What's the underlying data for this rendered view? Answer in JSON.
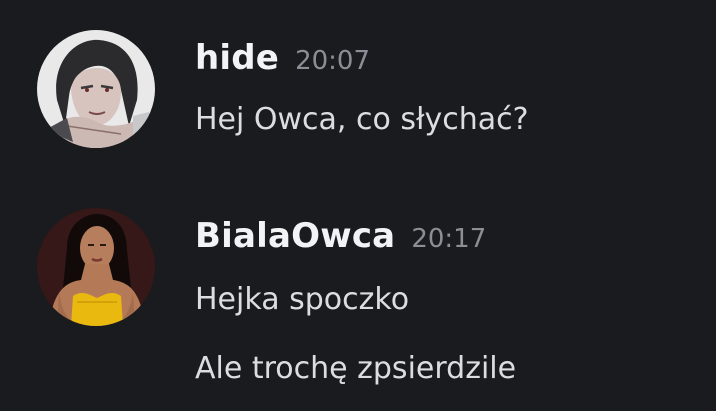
{
  "messages": [
    {
      "author": "hide",
      "time": "20:07",
      "avatar_icon": "avatar-sketch-character",
      "lines": [
        "Hej Owca, co słychać?"
      ]
    },
    {
      "author": "BialaOwca",
      "time": "20:17",
      "avatar_icon": "avatar-photo-woman",
      "lines": [
        "Hejka spoczko",
        "Ale trochę zpsierdzile"
      ]
    }
  ],
  "colors": {
    "background": "#1a1b1f",
    "username": "#f2f3f5",
    "timestamp": "#8c8e96",
    "message_text": "#dbdee1"
  }
}
